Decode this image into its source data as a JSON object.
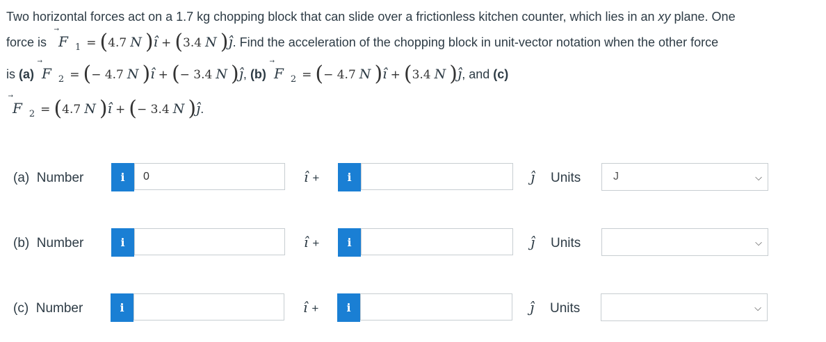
{
  "question": {
    "text1": "Two horizontal forces act on a 1.7 kg chopping block that can slide over a frictionless kitchen counter, which lies in an ",
    "xy": "xy",
    "text2": " plane. One",
    "force_is": "force is",
    "f1_sub": "1",
    "f1_x": "4.7",
    "f1_y": "3.4",
    "text3": ". Find the acceleration of the chopping block in unit-vector notation when the other force",
    "is": "is",
    "part_a": "(a)",
    "part_b": "(b)",
    "part_c": "(c)",
    "and": ", and",
    "f2_sub": "2",
    "a_x": "− 4.7",
    "a_y": "− 3.4",
    "b_x": "− 4.7",
    "b_y": "3.4",
    "c_x": "4.7",
    "c_y": "− 3.4",
    "unit_N": "N",
    "F": "F",
    "i_hat": "î",
    "j_hat": "ĵ"
  },
  "rows": [
    {
      "part": "(a)",
      "label": "Number",
      "info": "i",
      "x_value": "0",
      "y_value": "",
      "i_plus": "î",
      "plus": "+",
      "j": "ĵ",
      "units_label": "Units",
      "units_value": "J"
    },
    {
      "part": "(b)",
      "label": "Number",
      "info": "i",
      "x_value": "",
      "y_value": "",
      "i_plus": "î",
      "plus": "+",
      "j": "ĵ",
      "units_label": "Units",
      "units_value": ""
    },
    {
      "part": "(c)",
      "label": "Number",
      "info": "i",
      "x_value": "",
      "y_value": "",
      "i_plus": "î",
      "plus": "+",
      "j": "ĵ",
      "units_label": "Units",
      "units_value": ""
    }
  ],
  "icons": {
    "info": "info-icon",
    "chevron": "chevron-down-icon"
  }
}
